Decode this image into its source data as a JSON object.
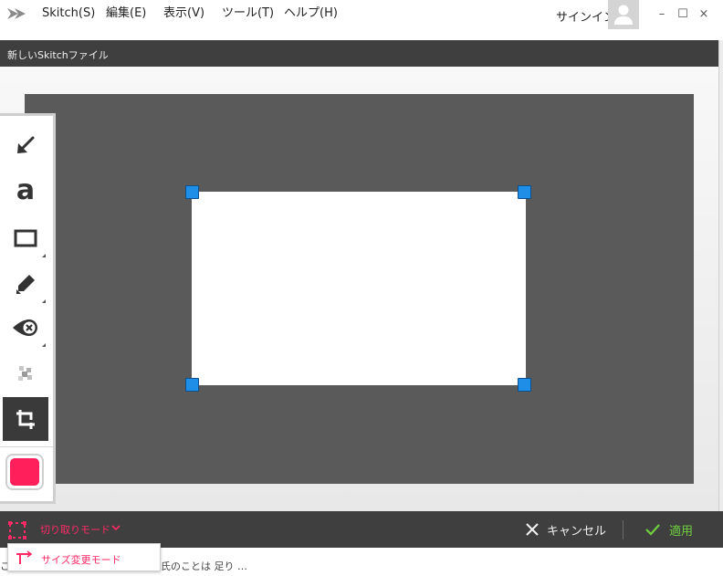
{
  "menu": {
    "items": [
      "Skitch(S)",
      "編集(E)",
      "表示(V)",
      "ツール(T)",
      "ヘルプ(H)"
    ],
    "signin_label": "サインイン"
  },
  "window": {
    "minimize_glyph": "–",
    "maximize_glyph": "☐",
    "close_glyph": "×"
  },
  "document": {
    "title": "新しいSkitchファイル"
  },
  "tools": [
    {
      "name": "arrow-tool",
      "icon": "arrow-icon"
    },
    {
      "name": "text-tool",
      "icon": "text-icon",
      "glyph": "a"
    },
    {
      "name": "shape-tool",
      "icon": "rectangle-icon"
    },
    {
      "name": "marker-tool",
      "icon": "marker-icon"
    },
    {
      "name": "stamp-tool",
      "icon": "stamp-icon"
    },
    {
      "name": "pixelate-tool",
      "icon": "pixelate-icon"
    },
    {
      "name": "crop-tool",
      "icon": "crop-icon",
      "active": true
    }
  ],
  "current_color": "#ff1f5b",
  "bottom_bar": {
    "mode_label": "切り取りモード",
    "cancel_label": "キャンセル",
    "apply_label": "適用"
  },
  "mode_popup": {
    "option_label": "サイズ変更モード"
  },
  "background_text": {
    "line1": "こ",
    "line2": "氏のことは 足り …"
  },
  "colors": {
    "accent": "#ff2a66",
    "apply_green": "#6fcf3f",
    "handle_blue": "#1f8ee6",
    "bar_dark": "#3f3f3f",
    "canvas_dark": "#5a5a5a"
  }
}
